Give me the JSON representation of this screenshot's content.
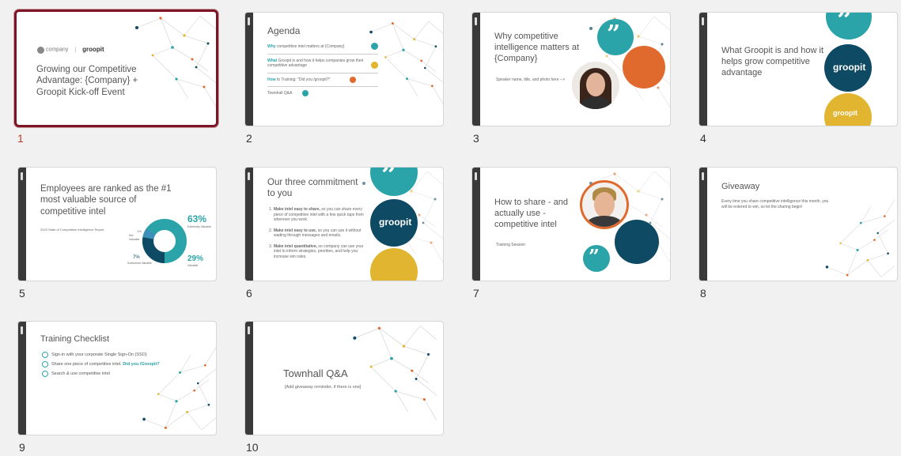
{
  "slides": [
    {
      "number": "1",
      "logo_company": "company",
      "logo_groopit": "groopit",
      "title": "Growing our Competitive Advantage: {Company} + Groopit Kick-off Event"
    },
    {
      "number": "2",
      "title": "Agenda",
      "items": [
        {
          "bold": "Why",
          "text": " competitive intel matters at {Company}"
        },
        {
          "bold": "What",
          "text": " Groopit is and how it helps companies grow their competitive advantage"
        },
        {
          "bold": "How",
          "text": " to Training: \"Did you /groopit?\""
        },
        {
          "bold": "",
          "text": "Townhall Q&A"
        }
      ]
    },
    {
      "number": "3",
      "title": "Why competitive intelligence matters at {Company}",
      "subtitle": "Speaker name, title, and photo here -->"
    },
    {
      "number": "4",
      "title": "What Groopit is and how it helps grow competitive advantage",
      "logo1": "groopit",
      "logo2": "groopit"
    },
    {
      "number": "5",
      "title": "Employees are ranked as the #1 most valuable source of competitive intel",
      "source": "2023 State of Competitive Intelligence Report",
      "stats": {
        "big": "63%",
        "big_label": "Extremely Valuable",
        "small": "29%",
        "small_label": "Valuable",
        "tiny": "7%",
        "tiny_label": "Somewhat Valuable",
        "tiny2": "1%",
        "tiny2_label": "Not Valuable"
      }
    },
    {
      "number": "6",
      "title": "Our three commitment to you",
      "items": [
        {
          "n": "1.",
          "bold": "Make intel easy to share,",
          "text": " so you can share every piece of competitive intel with a few quick taps from wherever you work."
        },
        {
          "n": "2.",
          "bold": "Make intel easy to use,",
          "text": " so you can use it without wading through messages and emails."
        },
        {
          "n": "3.",
          "bold": "Make intel quantitative,",
          "text": " so company can use your intel to inform strategies, priorities, and help you increase win rates."
        }
      ],
      "logo": "groopit"
    },
    {
      "number": "7",
      "title": "How to share - and actually use - competitive intel",
      "subtitle": "Training Session"
    },
    {
      "number": "8",
      "title": "Giveaway",
      "body": "Every time you share competitive intelligence this month, you will be entered to win, so let the sharing begin!"
    },
    {
      "number": "9",
      "title": "Training Checklist",
      "items": [
        {
          "text": "Sign-in with your corporate Single Sign-On (SSO)",
          "highlight": ""
        },
        {
          "text": "Share one piece of competitive intel.",
          "highlight": " Did you /Groopit?"
        },
        {
          "text": "Search & use competitive intel",
          "highlight": ""
        }
      ]
    },
    {
      "number": "10",
      "title": "Townhall Q&A",
      "subtitle": "[Add giveaway reminder, if there is one]"
    }
  ],
  "colors": {
    "teal": "#2ba4a9",
    "navy": "#0e4a63",
    "gold": "#e2b530",
    "orange": "#e06a2e",
    "selected_border": "#7d1525",
    "active_number": "#c0392b"
  }
}
